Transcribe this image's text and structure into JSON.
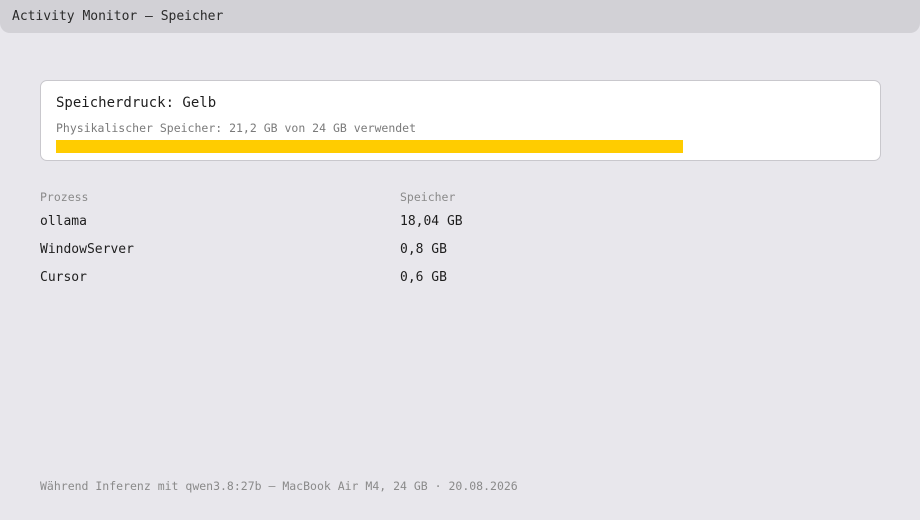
{
  "window": {
    "title": "Activity Monitor — Speicher"
  },
  "pressure": {
    "title": "Speicherdruck: Gelb",
    "detail": "Physikalischer Speicher: 21,2 GB von 24 GB verwendet",
    "level_fraction": 0.88,
    "color": "#ffcc00"
  },
  "table": {
    "headers": {
      "process": "Prozess",
      "memory": "Speicher"
    },
    "rows": [
      {
        "process": "ollama",
        "memory": "18,04 GB"
      },
      {
        "process": "WindowServer",
        "memory": "0,8 GB"
      },
      {
        "process": "Cursor",
        "memory": "0,6 GB"
      }
    ]
  },
  "footer": {
    "text": "Während Inferenz mit qwen3.8:27b — MacBook Air M4, 24 GB · 20.08.2026"
  }
}
